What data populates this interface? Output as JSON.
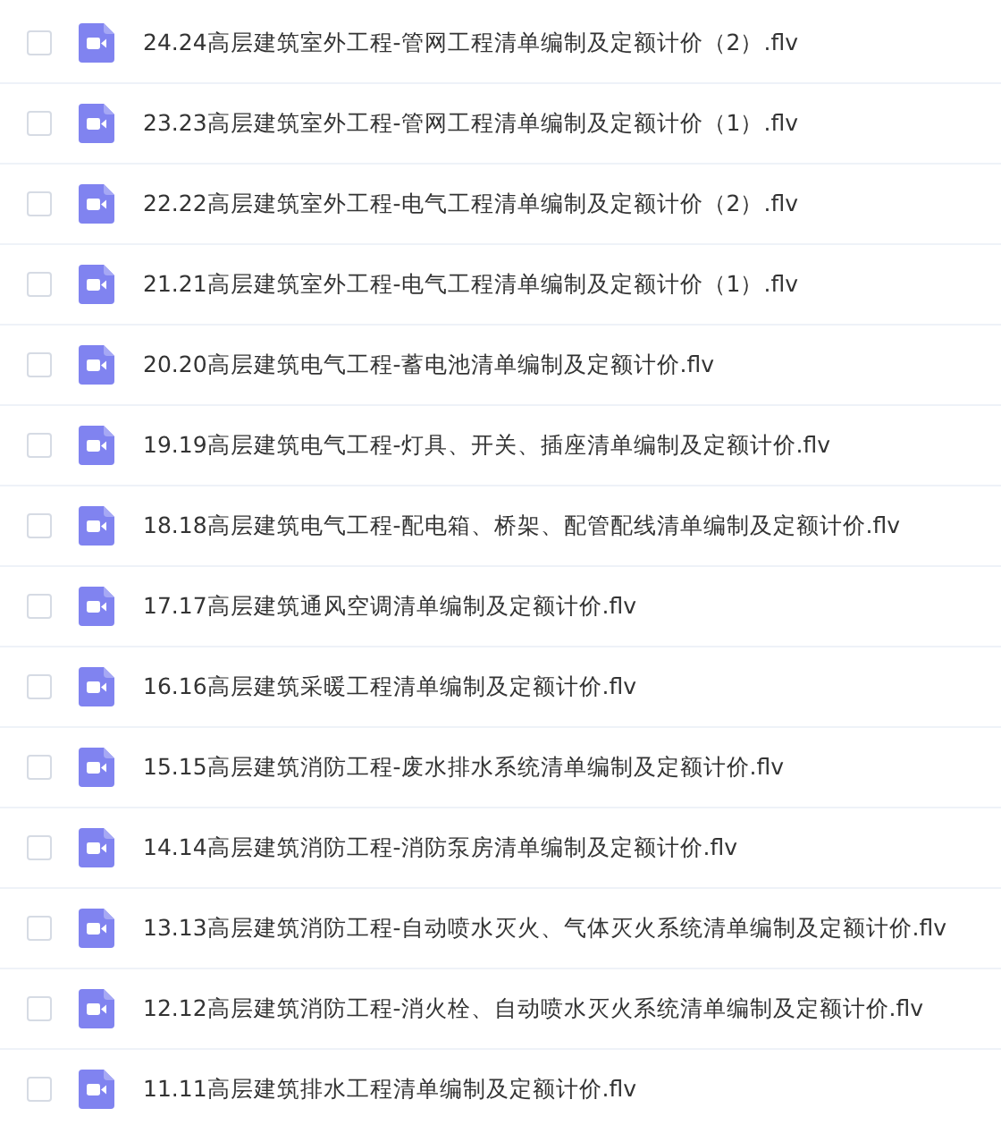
{
  "files": [
    {
      "name": "24.24高层建筑室外工程-管网工程清单编制及定额计价（2）.flv",
      "checked": false
    },
    {
      "name": "23.23高层建筑室外工程-管网工程清单编制及定额计价（1）.flv",
      "checked": false
    },
    {
      "name": "22.22高层建筑室外工程-电气工程清单编制及定额计价（2）.flv",
      "checked": false
    },
    {
      "name": "21.21高层建筑室外工程-电气工程清单编制及定额计价（1）.flv",
      "checked": false
    },
    {
      "name": "20.20高层建筑电气工程-蓄电池清单编制及定额计价.flv",
      "checked": false
    },
    {
      "name": "19.19高层建筑电气工程-灯具、开关、插座清单编制及定额计价.flv",
      "checked": false
    },
    {
      "name": "18.18高层建筑电气工程-配电箱、桥架、配管配线清单编制及定额计价.flv",
      "checked": false
    },
    {
      "name": "17.17高层建筑通风空调清单编制及定额计价.flv",
      "checked": false
    },
    {
      "name": "16.16高层建筑采暖工程清单编制及定额计价.flv",
      "checked": false
    },
    {
      "name": "15.15高层建筑消防工程-废水排水系统清单编制及定额计价.flv",
      "checked": false
    },
    {
      "name": "14.14高层建筑消防工程-消防泵房清单编制及定额计价.flv",
      "checked": false
    },
    {
      "name": "13.13高层建筑消防工程-自动喷水灭火、气体灭火系统清单编制及定额计价.flv",
      "checked": false
    },
    {
      "name": "12.12高层建筑消防工程-消火栓、自动喷水灭火系统清单编制及定额计价.flv",
      "checked": false
    },
    {
      "name": "11.11高层建筑排水工程清单编制及定额计价.flv",
      "checked": false
    }
  ]
}
